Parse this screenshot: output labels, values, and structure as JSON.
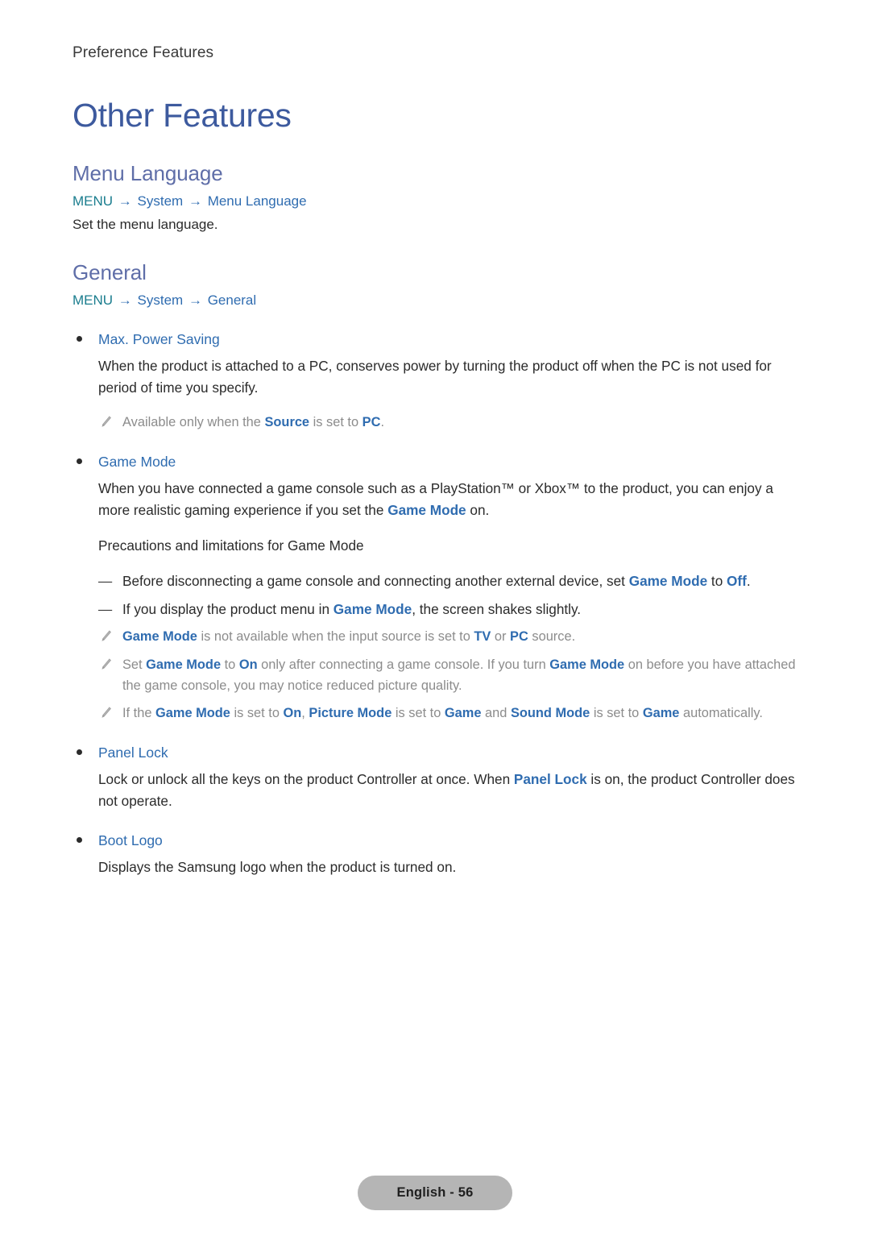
{
  "running_header": "Preference Features",
  "doc_title": "Other Features",
  "sections": [
    {
      "title": "Menu Language",
      "menu_path": {
        "root": "MENU",
        "arrow": "→",
        "segments": [
          "System",
          "Menu Language"
        ]
      },
      "description": "Set the menu language."
    },
    {
      "title": "General",
      "menu_path": {
        "root": "MENU",
        "arrow": "→",
        "segments": [
          "System",
          "General"
        ]
      }
    }
  ],
  "features": [
    {
      "name": "Max. Power Saving",
      "paragraph_pre": "When the product is attached to a PC, conserves power by turning the product off when the PC is not used for period of time you specify.",
      "notes": [
        {
          "parts": [
            {
              "t": "Available only when the ",
              "hl": false
            },
            {
              "t": "Source",
              "hl": true
            },
            {
              "t": " is set to ",
              "hl": false
            },
            {
              "t": "PC",
              "hl": true
            },
            {
              "t": ".",
              "hl": false
            }
          ]
        }
      ]
    },
    {
      "name": "Game Mode",
      "paragraph_parts": [
        {
          "t": "When you have connected a game console such as a PlayStation™ or Xbox™ to the product, you can enjoy a more realistic gaming experience if you set the ",
          "hl": false
        },
        {
          "t": "Game Mode",
          "hl": true
        },
        {
          "t": " on.",
          "hl": false
        }
      ],
      "subhead": "Precautions and limitations for Game Mode",
      "dashes": [
        {
          "marker": "—",
          "parts": [
            {
              "t": "Before disconnecting a game console and connecting another external device, set ",
              "hl": false
            },
            {
              "t": "Game Mode",
              "hl": true
            },
            {
              "t": " to ",
              "hl": false
            },
            {
              "t": "Off",
              "hl": true
            },
            {
              "t": ".",
              "hl": false
            }
          ]
        },
        {
          "marker": "—",
          "parts": [
            {
              "t": "If you display the product menu in ",
              "hl": false
            },
            {
              "t": "Game Mode",
              "hl": true
            },
            {
              "t": ", the screen shakes slightly.",
              "hl": false
            }
          ]
        }
      ],
      "notes": [
        {
          "parts": [
            {
              "t": "Game Mode",
              "hl": true
            },
            {
              "t": " is not available when the input source is set to ",
              "hl": false
            },
            {
              "t": "TV",
              "hl": true
            },
            {
              "t": " or ",
              "hl": false
            },
            {
              "t": "PC",
              "hl": true
            },
            {
              "t": " source.",
              "hl": false
            }
          ]
        },
        {
          "parts": [
            {
              "t": "Set ",
              "hl": false
            },
            {
              "t": "Game Mode",
              "hl": true
            },
            {
              "t": " to ",
              "hl": false
            },
            {
              "t": "On",
              "hl": true
            },
            {
              "t": " only after connecting a game console. If you turn ",
              "hl": false
            },
            {
              "t": "Game Mode",
              "hl": true
            },
            {
              "t": " on before you have attached the game console, you may notice reduced picture quality.",
              "hl": false
            }
          ]
        },
        {
          "parts": [
            {
              "t": "If the ",
              "hl": false
            },
            {
              "t": "Game Mode",
              "hl": true
            },
            {
              "t": " is set to ",
              "hl": false
            },
            {
              "t": "On",
              "hl": true
            },
            {
              "t": ", ",
              "hl": false
            },
            {
              "t": "Picture Mode",
              "hl": true
            },
            {
              "t": " is set to ",
              "hl": false
            },
            {
              "t": "Game",
              "hl": true
            },
            {
              "t": " and ",
              "hl": false
            },
            {
              "t": "Sound Mode",
              "hl": true
            },
            {
              "t": " is set to ",
              "hl": false
            },
            {
              "t": "Game",
              "hl": true
            },
            {
              "t": " automatically.",
              "hl": false
            }
          ]
        }
      ]
    },
    {
      "name": "Panel Lock",
      "paragraph_parts": [
        {
          "t": "Lock or unlock all the keys on the product Controller at once. When ",
          "hl": false
        },
        {
          "t": "Panel Lock",
          "hl": true
        },
        {
          "t": " is on, the product Controller does not operate.",
          "hl": false
        }
      ]
    },
    {
      "name": "Boot Logo",
      "paragraph_pre": "Displays the Samsung logo when the product is turned on."
    }
  ],
  "footer": {
    "label": "English - 56"
  },
  "colors": {
    "doc_title": "#3d5a9e",
    "section_title": "#5f6ea8",
    "menu_root": "#1a7d8e",
    "menu_segment": "#2f6cb0",
    "highlight": "#2f6cb0",
    "body": "#2b2b2b",
    "note": "#8c8c8c",
    "footer_pill": "#b5b5b5"
  },
  "icons": {
    "note": "pencil-icon"
  }
}
